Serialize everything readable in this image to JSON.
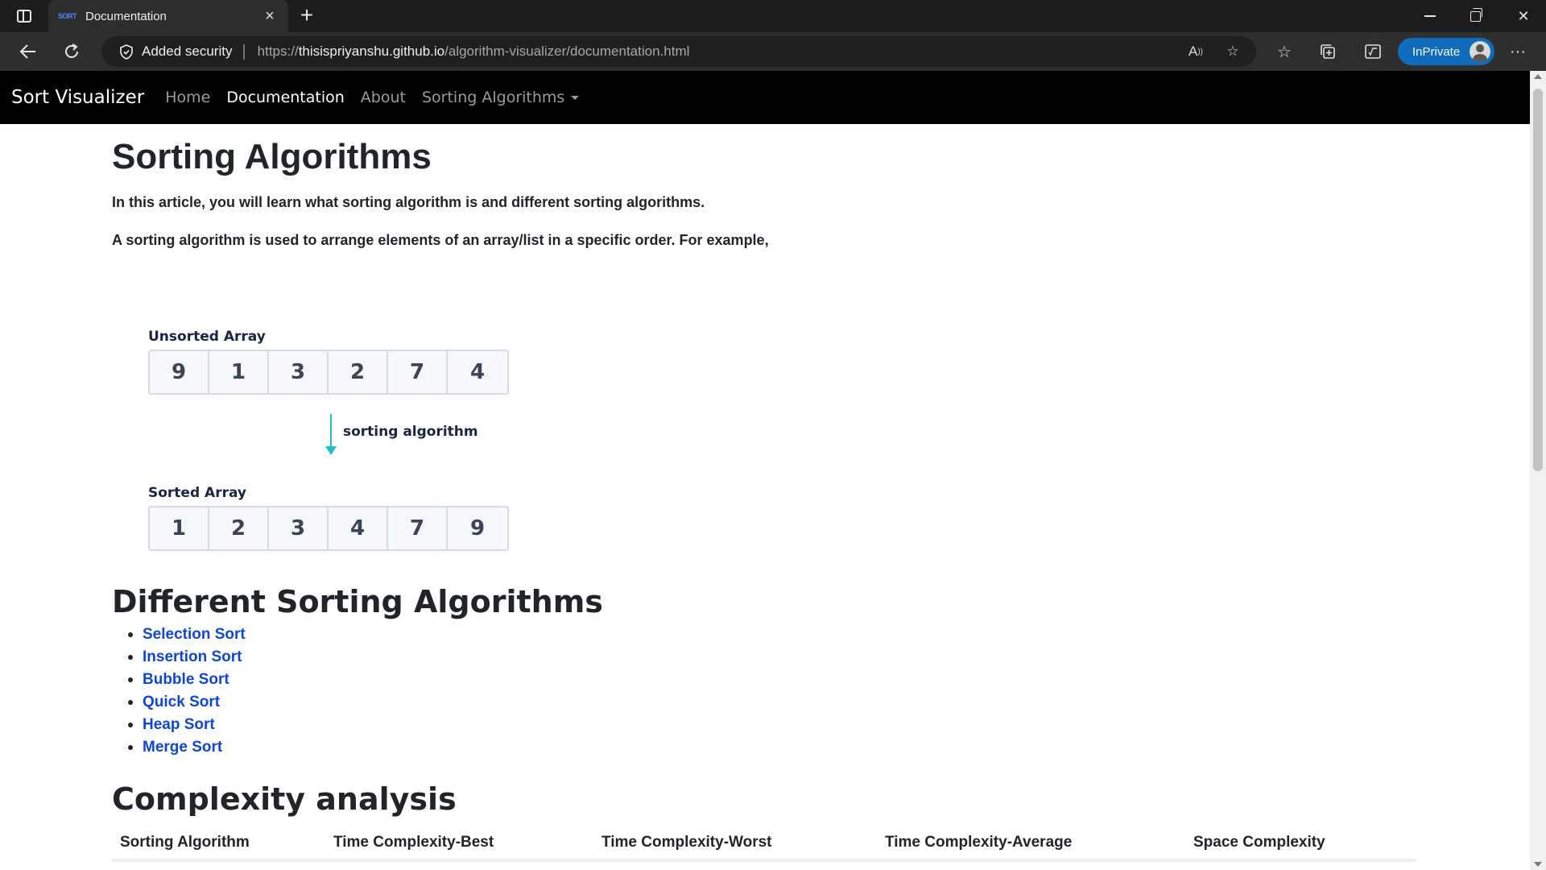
{
  "browser": {
    "tab_title": "Documentation",
    "tab_favicon_text": "SORT",
    "security_label": "Added security",
    "url_scheme": "https://",
    "url_host": "thisispriyanshu.github.io",
    "url_path": "/algorithm-visualizer/documentation.html",
    "inprivate_label": "InPrivate",
    "accent_color": "#0f6cbd"
  },
  "site_nav": {
    "brand": "Sort Visualizer",
    "links": [
      "Home",
      "Documentation",
      "About",
      "Sorting Algorithms"
    ],
    "active_link": "Documentation"
  },
  "article": {
    "title": "Sorting Algorithms",
    "intro": "In this article, you will learn what sorting algorithm is and different sorting algorithms.",
    "definition": "A sorting algorithm is used to arrange elements of an array/list in a specific order. For example,"
  },
  "figure": {
    "unsorted_caption": "Unsorted Array",
    "unsorted_values": [
      "9",
      "1",
      "3",
      "2",
      "7",
      "4"
    ],
    "arrow_label": "sorting algorithm",
    "sorted_caption": "Sorted Array",
    "sorted_values": [
      "1",
      "2",
      "3",
      "4",
      "7",
      "9"
    ],
    "arrow_color": "#1ec3c9"
  },
  "algorithms_section": {
    "heading": "Different Sorting Algorithms",
    "items": [
      "Selection Sort",
      "Insertion Sort",
      "Bubble Sort",
      "Quick Sort",
      "Heap Sort",
      "Merge Sort"
    ],
    "link_color": "#0d47d4"
  },
  "complexity_section": {
    "heading": "Complexity analysis",
    "columns": [
      "Sorting Algorithm",
      "Time Complexity-Best",
      "Time Complexity-Worst",
      "Time Complexity-Average",
      "Space Complexity"
    ]
  }
}
